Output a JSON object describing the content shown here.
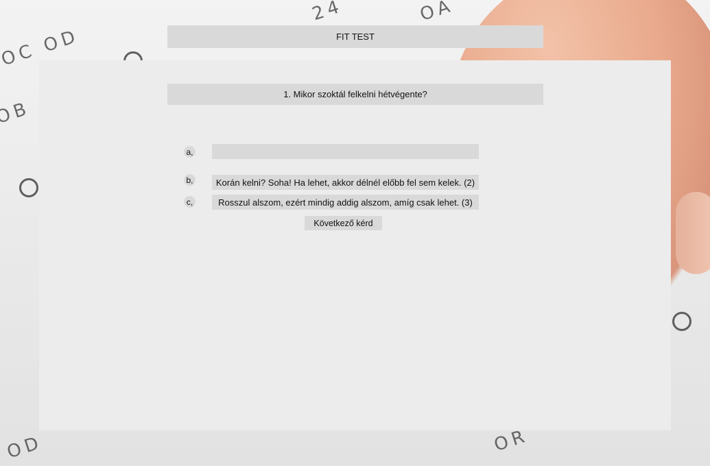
{
  "header": {
    "title": "FIT TEST"
  },
  "question": {
    "text": "1. Mikor szoktál felkelni hétvégente?"
  },
  "options": [
    {
      "letter": "a,",
      "text": ""
    },
    {
      "letter": "b,",
      "text": "Korán kelni? Soha! Ha lehet, akkor délnél előbb fel sem kelek. (2)"
    },
    {
      "letter": "c,",
      "text": "Rosszul alszom, ezért mindig addig alszom, amíg csak lehet. (3)"
    }
  ],
  "actions": {
    "next_label": "Következő kérd"
  }
}
